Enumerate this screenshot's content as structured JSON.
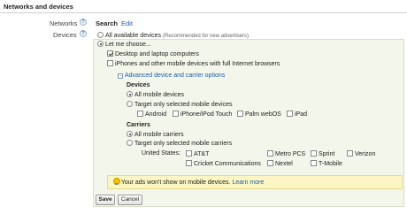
{
  "section": {
    "title": "Networks and devices"
  },
  "networks": {
    "label": "Networks",
    "value": "Search",
    "edit": "Edit"
  },
  "devices": {
    "label": "Devices",
    "all_available": "All available devices",
    "all_available_note": "(Recommended for new advertisers)",
    "let_me_choose": "Let me choose...",
    "desktop": "Desktop and laptop computers",
    "mobile_full": "iPhones and other mobile devices with full Internet browsers",
    "advanced_link": "Advanced device and carrier options",
    "devices_heading": "Devices",
    "all_mobile_devices": "All mobile devices",
    "target_devices": "Target only selected mobile devices",
    "device_options": [
      "Android",
      "iPhone/iPod Touch",
      "Palm webOS",
      "iPad"
    ],
    "carriers_heading": "Carriers",
    "all_mobile_carriers": "All mobile carriers",
    "target_carriers": "Target only selected mobile carriers",
    "united_states": "United States:",
    "carriers": [
      "AT&T",
      "Metro PCS",
      "Sprint",
      "Verizon",
      "Cricket Communications",
      "Nextel",
      "T-Mobile"
    ]
  },
  "tip": {
    "text": "Your ads won't show on mobile devices.",
    "link": "Learn more"
  },
  "buttons": {
    "save": "Save",
    "cancel": "Cancel"
  },
  "icons": {
    "help": "help-icon",
    "tip": "lightbulb-icon",
    "collapse": "collapse-minus-icon"
  },
  "colors": {
    "panel": "#f3f6ea",
    "tip": "#fbf6c4",
    "link": "#1a5fb4"
  }
}
